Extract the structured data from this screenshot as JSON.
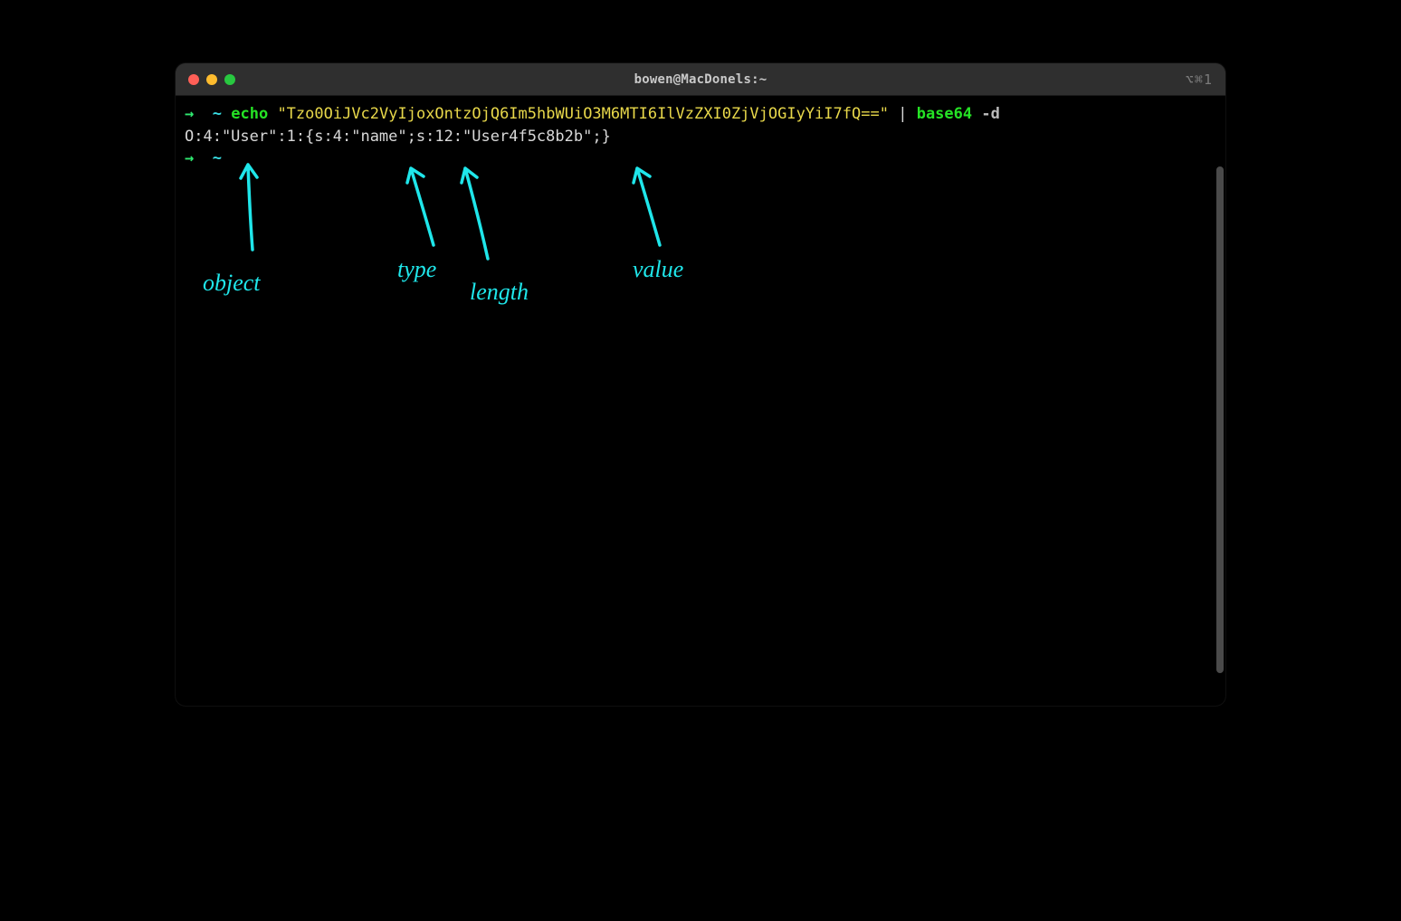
{
  "window": {
    "title": "bowen@MacDonels:~",
    "shortcut_hint": "⌥⌘1"
  },
  "terminal": {
    "lines": [
      {
        "prompt_arrow": "→",
        "tilde": "~",
        "cmd1": "echo",
        "string": "\"Tzo0OiJVc2VyIjoxOntzOjQ6Im5hbWUiO3M6MTI6IlVzZXI0ZjVjOGIyYiI7fQ==\"",
        "pipe": "|",
        "cmd2": "base64",
        "flag": "-d"
      },
      {
        "output": "O:4:\"User\":1:{s:4:\"name\";s:12:\"User4f5c8b2b\";}"
      },
      {
        "prompt_arrow": "→",
        "tilde": "~"
      }
    ]
  },
  "annotations": {
    "label_object": "object",
    "label_type": "type",
    "label_length": "length",
    "label_value": "value"
  },
  "colors": {
    "annotation": "#1fe6ea",
    "prompt_arrow": "#2fe870",
    "tilde": "#39e0e6",
    "command": "#25e325",
    "string": "#e8d84a"
  }
}
